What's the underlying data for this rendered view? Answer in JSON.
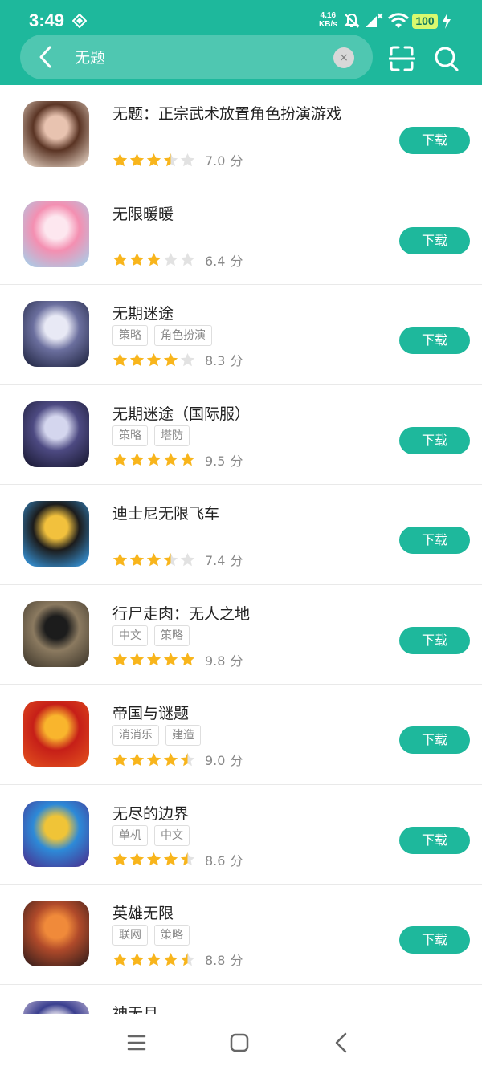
{
  "status": {
    "time": "3:49",
    "net_speed_value": "4.16",
    "net_speed_unit": "KB/s",
    "battery": "100"
  },
  "search": {
    "query": "无题",
    "clear_glyph": "×",
    "icons": [
      "back-arrow-icon",
      "clear-icon",
      "scan-icon",
      "search-icon"
    ]
  },
  "colors": {
    "accent": "#1eb89c",
    "star_filled": "#f8b51c",
    "star_empty": "#e2e2e2",
    "battery_bg": "#d9f96e"
  },
  "download_label": "下载",
  "score_unit": "分",
  "apps": [
    {
      "name": "无题：正宗武术放置角色扮演游戏",
      "tags": [],
      "rating": 3.5,
      "score": "7.0"
    },
    {
      "name": "无限暖暖",
      "tags": [],
      "rating": 3,
      "score": "6.4"
    },
    {
      "name": "无期迷途",
      "tags": [
        "策略",
        "角色扮演"
      ],
      "rating": 4,
      "score": "8.3"
    },
    {
      "name": "无期迷途（国际服）",
      "tags": [
        "策略",
        "塔防"
      ],
      "rating": 5,
      "score": "9.5"
    },
    {
      "name": "迪士尼无限飞车",
      "tags": [],
      "rating": 3.5,
      "score": "7.4"
    },
    {
      "name": "行尸走肉：无人之地",
      "tags": [
        "中文",
        "策略"
      ],
      "rating": 5,
      "score": "9.8"
    },
    {
      "name": "帝国与谜题",
      "tags": [
        "消消乐",
        "建造"
      ],
      "rating": 4.5,
      "score": "9.0"
    },
    {
      "name": "无尽的边界",
      "tags": [
        "单机",
        "中文"
      ],
      "rating": 4.5,
      "score": "8.6"
    },
    {
      "name": "英雄无限",
      "tags": [
        "联网",
        "策略"
      ],
      "rating": 4.5,
      "score": "8.8"
    },
    {
      "name": "神无月",
      "tags": [],
      "rating": 0,
      "score": ""
    }
  ],
  "navbar": [
    "menu-icon",
    "home-icon",
    "back-icon"
  ]
}
